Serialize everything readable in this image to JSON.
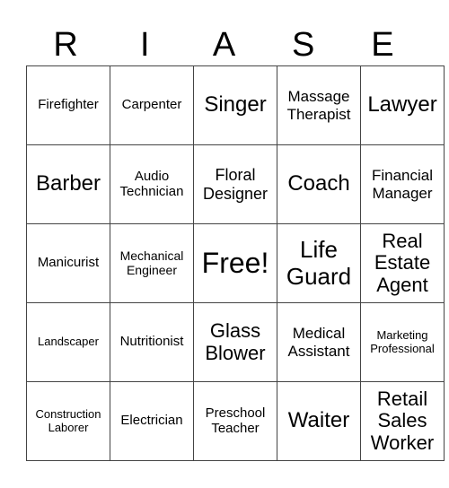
{
  "header": [
    "R",
    "I",
    "A",
    "S",
    "E"
  ],
  "rows": [
    [
      "Firefighter",
      "Carpenter",
      "Singer",
      "Massage Therapist",
      "Lawyer"
    ],
    [
      "Barber",
      "Audio Technician",
      "Floral Designer",
      "Coach",
      "Financial Manager"
    ],
    [
      "Manicurist",
      "Mechanical Engineer",
      "Free!",
      "Life Guard",
      "Real Estate Agent"
    ],
    [
      "Landscaper",
      "Nutritionist",
      "Glass Blower",
      "Medical Assistant",
      "Marketing Professional"
    ],
    [
      "Construction Laborer",
      "Electrician",
      "Preschool Teacher",
      "Waiter",
      "Retail Sales Worker"
    ]
  ]
}
